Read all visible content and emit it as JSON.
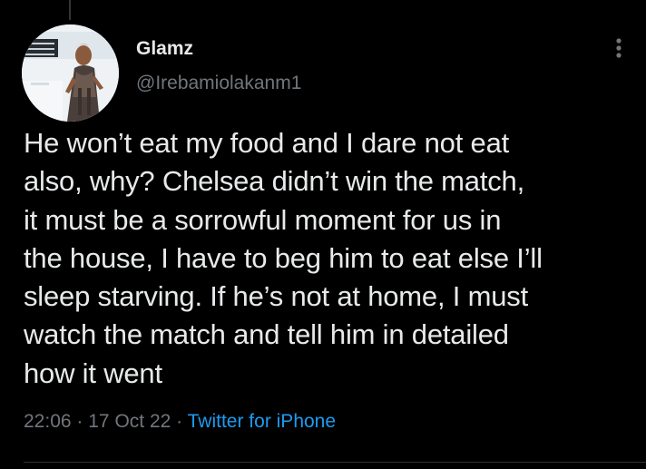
{
  "author": {
    "display_name": "Glamz",
    "handle": "@Irebamiolakanm1"
  },
  "tweet": {
    "lines": [
      "He won’t eat my food and I dare not eat",
      "also, why? Chelsea didn’t win the match,",
      "it must be a sorrowful moment for us in",
      "the house, I have to beg him to eat else I’ll",
      "sleep starving. If he’s not at home, I must",
      "watch the match and tell him in detailed",
      "how it went"
    ],
    "time": "22:06",
    "separator": "·",
    "date": "17 Oct 22",
    "source": "Twitter for iPhone"
  },
  "icons": {
    "more": "more-vertical-icon",
    "avatar": "profile-photo"
  },
  "colors": {
    "background": "#000000",
    "text": "#e7e9ea",
    "secondary": "#71767b",
    "link": "#1d9bf0"
  }
}
